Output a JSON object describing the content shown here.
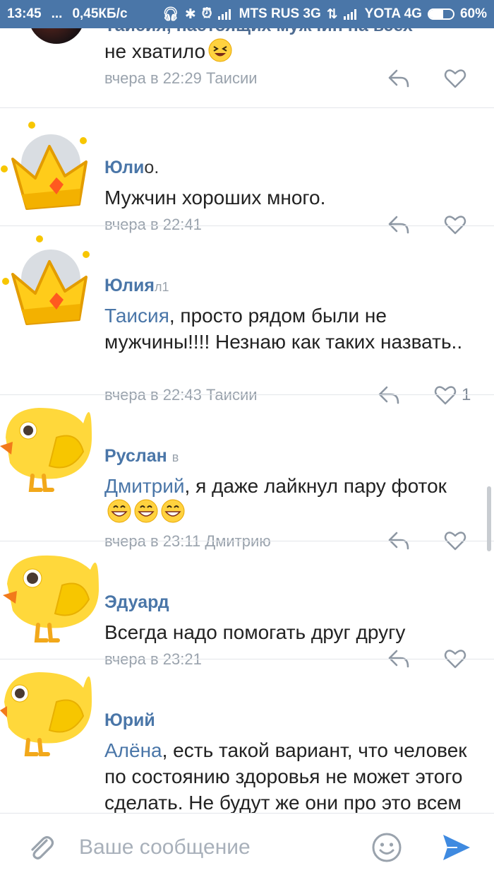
{
  "status_bar": {
    "time": "13:45",
    "dots": "...",
    "speed": "0,45КБ/с",
    "carrier1": "MTS RUS 3G",
    "carrier2": "YOTA 4G",
    "battery": "60%",
    "battery_level": 0.6
  },
  "comments": [
    {
      "author": "Таисия, настоящих мужчин на всех",
      "text": "не хватило",
      "time": "вчера в 22:29",
      "reply_to": "Таисии",
      "likes": ""
    },
    {
      "author": "Юли",
      "author_extra": "о.",
      "text": "Мужчин хороших много.",
      "time": "вчера в 22:41",
      "reply_to": "",
      "likes": ""
    },
    {
      "author": "Юлия",
      "author_extra": "л1",
      "mention": "Таисия",
      "text": ", просто рядом были не мужчины!!!! Незнаю как таких назвать..",
      "time": "вчера в 22:43",
      "reply_to": "Таисии",
      "likes": "1"
    },
    {
      "author": "Руслан",
      "author_extra": "в",
      "mention": "Дмитрий",
      "text": ", я даже лайкнул пару фоток",
      "time": "вчера в 23:11",
      "reply_to": "Дмитрию",
      "likes": ""
    },
    {
      "author": "Эдуард",
      "text": "Всегда надо помогать друг другу",
      "time": "вчера в 23:21",
      "reply_to": "",
      "likes": ""
    },
    {
      "author": "Юрий",
      "mention": "Алёна",
      "text": ", есть такой вариант,  что человек по состоянию здоровья не может этого сделать. Не будут же они про это всем рассказывать."
    }
  ],
  "composer": {
    "placeholder": "Ваше сообщение"
  },
  "icons": {
    "attach": "paperclip-icon",
    "smile": "emoji-icon",
    "send": "send-icon",
    "reply": "reply-icon",
    "like": "heart-icon"
  },
  "colors": {
    "brand": "#4a76a8",
    "author": "#4a76a8",
    "meta": "#9aa3ad",
    "send": "#3f8ae0"
  }
}
